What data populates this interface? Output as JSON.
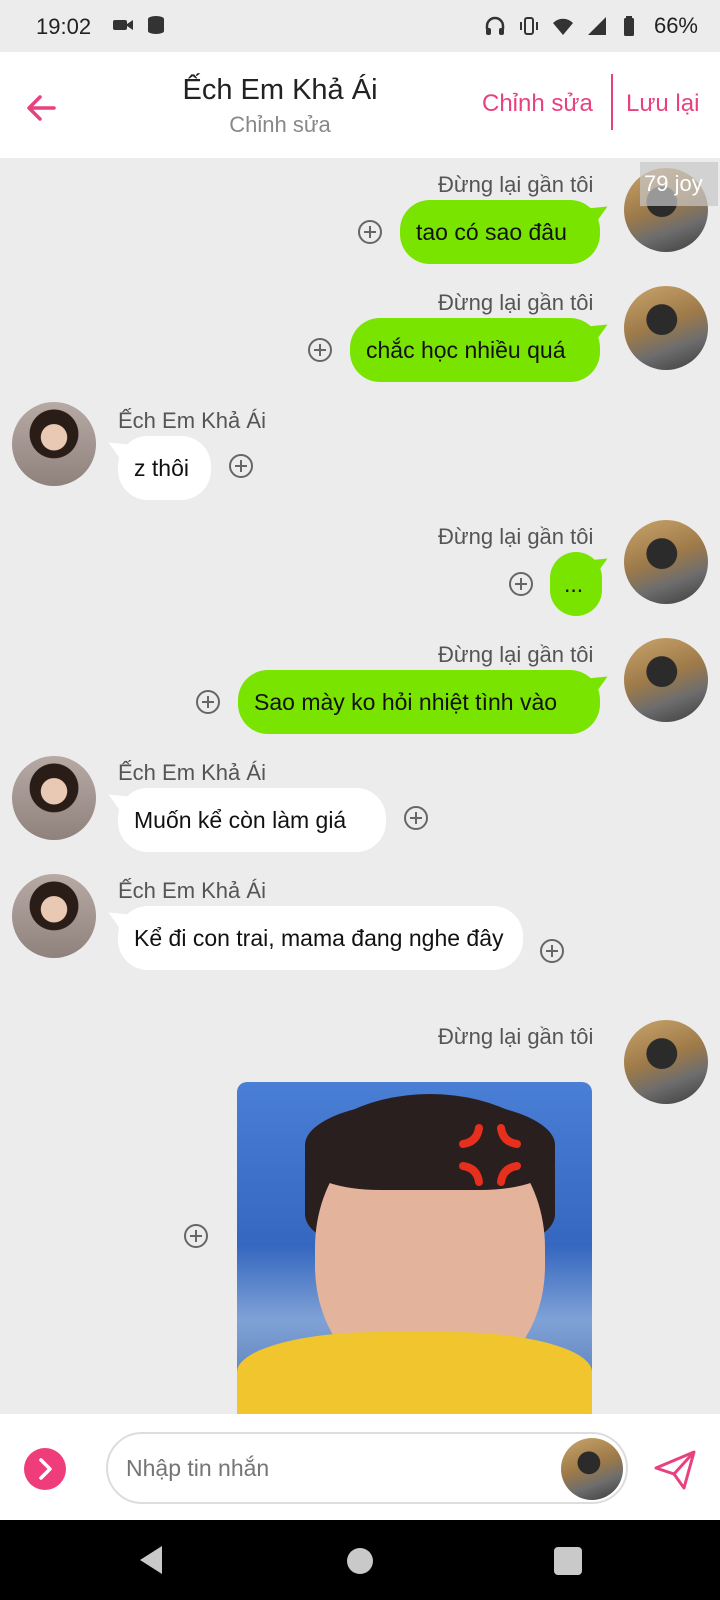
{
  "status_bar": {
    "time": "19:02",
    "battery": "66%",
    "icons": [
      "video-icon",
      "data-icon",
      "headphones-icon",
      "vibrate-icon",
      "wifi-icon",
      "signal-icon",
      "battery-icon"
    ]
  },
  "header": {
    "title": "Ếch Em Khả Ái",
    "subtitle": "Chỉnh sửa",
    "edit_label": "Chỉnh sửa",
    "save_label": "Lưu lại",
    "accent_color": "#e8417f"
  },
  "chat": {
    "badge": "79 joy",
    "messages": [
      {
        "side": "out",
        "sender": "Đừng lại gần tôi",
        "text": "tao có sao đâu"
      },
      {
        "side": "out",
        "sender": "Đừng lại gần tôi",
        "text": "chắc học nhiều quá"
      },
      {
        "side": "in",
        "sender": "Ếch Em Khả Ái",
        "text": "z thôi"
      },
      {
        "side": "out",
        "sender": "Đừng lại gần tôi",
        "text": "..."
      },
      {
        "side": "out",
        "sender": "Đừng lại gần tôi",
        "text": "Sao mày ko hỏi nhiệt tình vào"
      },
      {
        "side": "in",
        "sender": "Ếch Em Khả Ái",
        "text": "Muốn kể còn làm giá"
      },
      {
        "side": "in",
        "sender": "Ếch Em Khả Ái",
        "text": "Kể đi con trai, mama đang nghe đây"
      },
      {
        "side": "out",
        "sender": "Đừng lại gần tôi",
        "type": "image"
      }
    ],
    "bubble_out_color": "#79e400",
    "bubble_in_color": "#ffffff"
  },
  "input_bar": {
    "placeholder": "Nhập tin nhắn"
  }
}
